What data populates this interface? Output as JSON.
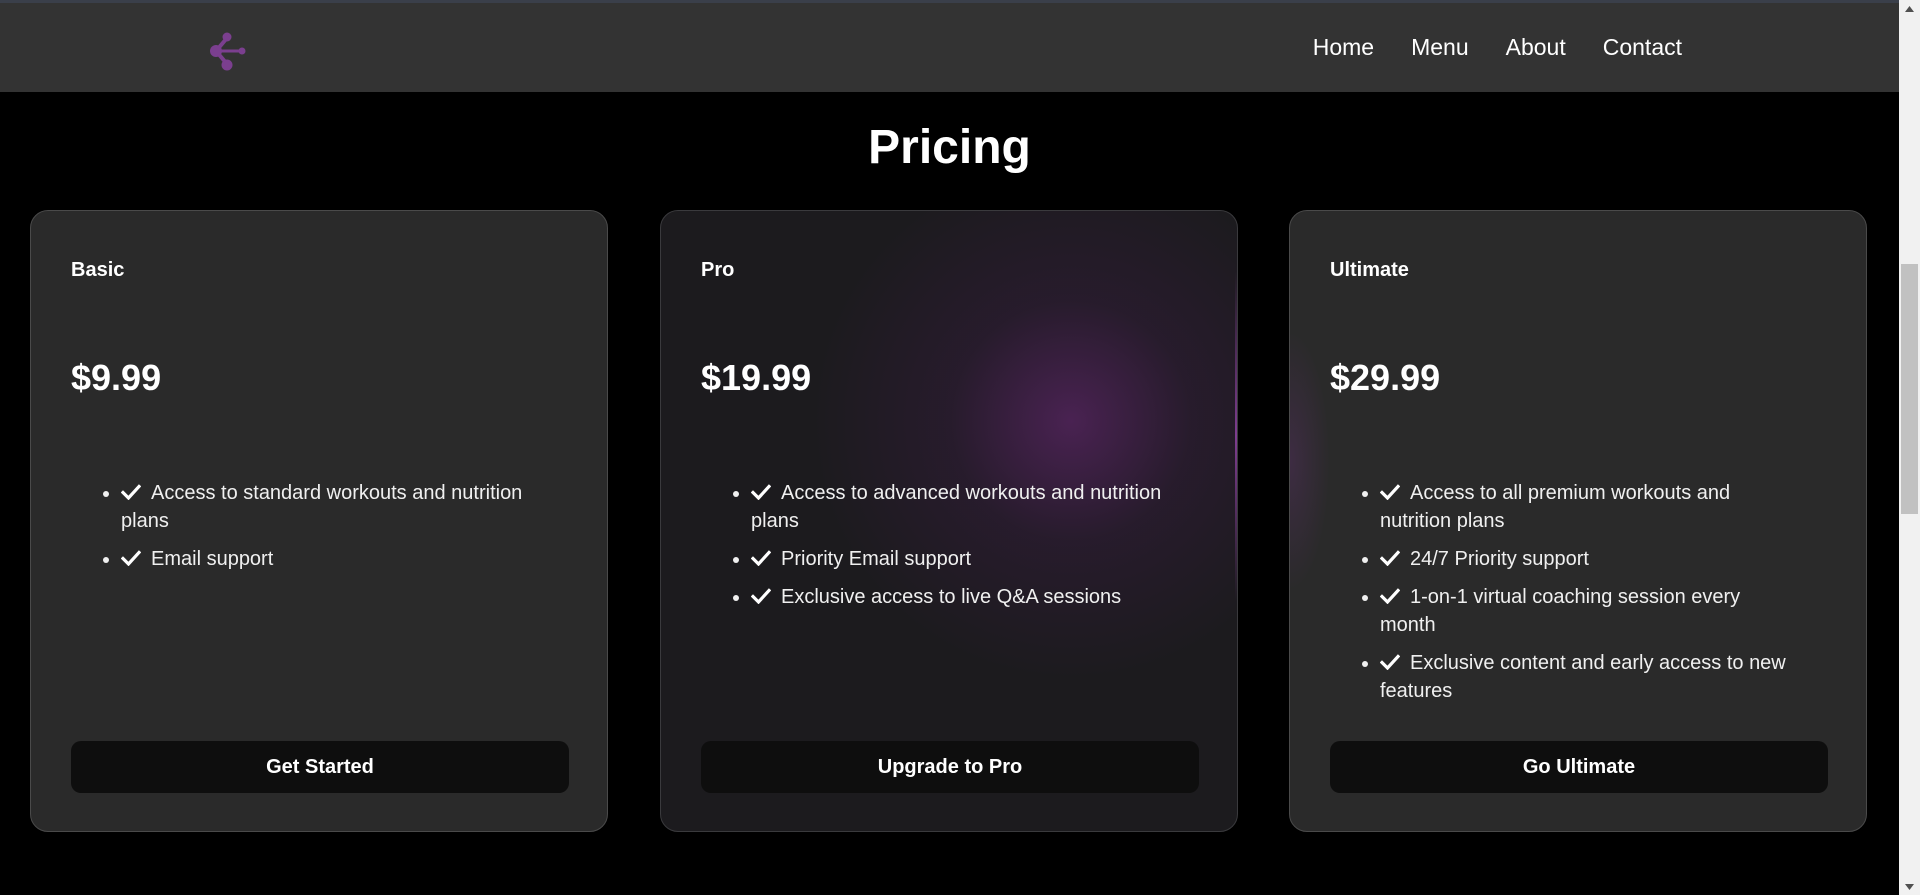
{
  "nav": {
    "logo_icon": "share-nodes-icon",
    "logo_color": "#7b3f8f",
    "links": [
      {
        "label": "Home"
      },
      {
        "label": "Menu"
      },
      {
        "label": "About"
      },
      {
        "label": "Contact"
      }
    ]
  },
  "pricing": {
    "title": "Pricing",
    "plans": [
      {
        "name": "Basic",
        "price": "$9.99",
        "features": [
          "Access to standard workouts and nutrition plans",
          "Email support"
        ],
        "button": "Get Started"
      },
      {
        "name": "Pro",
        "price": "$19.99",
        "features": [
          "Access to advanced workouts and nutrition plans",
          "Priority Email support",
          "Exclusive access to live Q&A sessions"
        ],
        "button": "Upgrade to Pro"
      },
      {
        "name": "Ultimate",
        "price": "$29.99",
        "features": [
          "Access to all premium workouts and nutrition plans",
          "24/7 Priority support",
          "1-on-1 virtual coaching session every month",
          "Exclusive content and early access to new features"
        ],
        "button": "Go Ultimate"
      }
    ]
  },
  "colors": {
    "page_background": "#000000",
    "navbar_background": "#333333",
    "card_background": "#2a2a2a",
    "button_background": "#0e0e0e",
    "accent_purple": "#7b3f8f"
  },
  "icons": {
    "check": "check-icon"
  }
}
